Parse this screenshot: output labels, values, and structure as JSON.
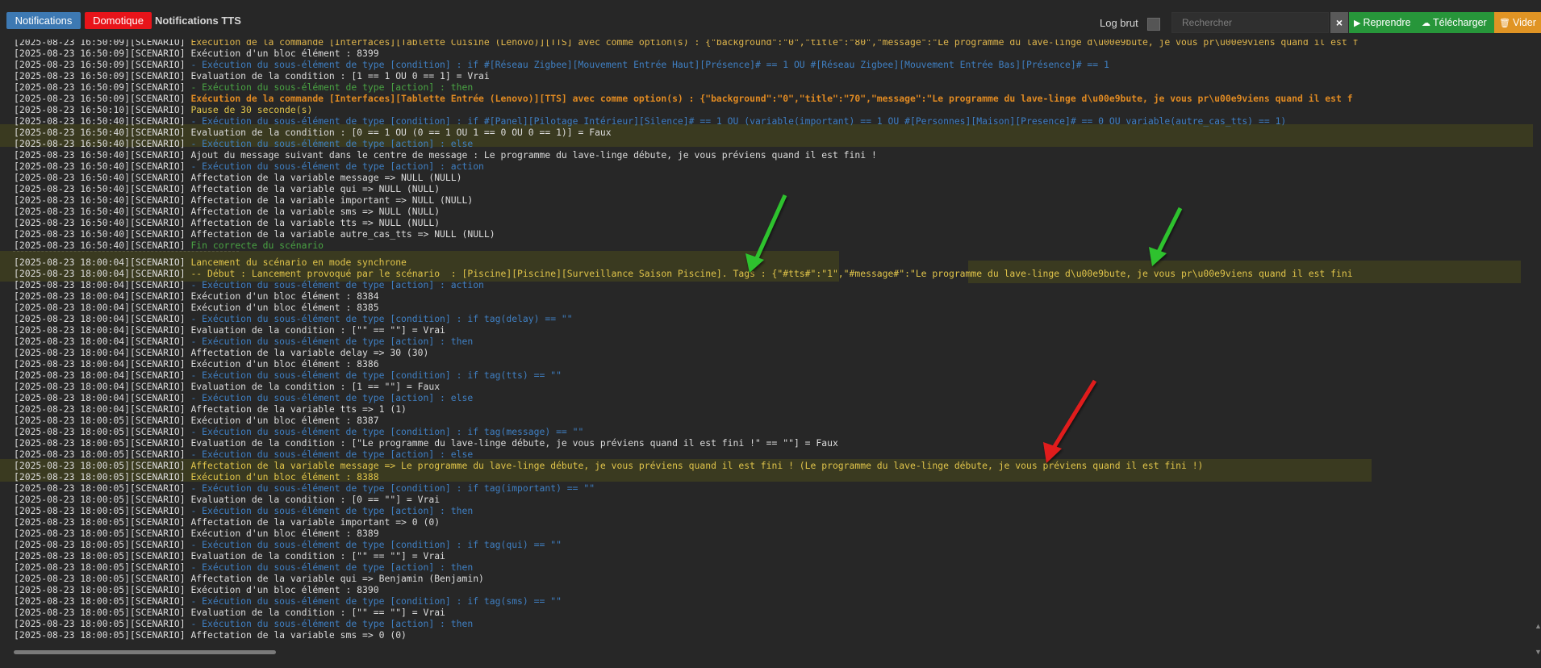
{
  "header": {
    "breadcrumb": [
      "Notifications",
      "Domotique",
      "Notifications TTS"
    ],
    "log_raw_label": "Log brut",
    "search_placeholder": "Rechercher",
    "clear_label": "×",
    "resume_label": "Reprendre",
    "download_label": "Télécharger",
    "empty_label": "Vider"
  },
  "colors": {
    "breadcrumb_1": "#3d79b3",
    "breadcrumb_2": "#e8141a",
    "resume": "#27963a",
    "download": "#27963a",
    "empty": "#e09424",
    "arrow_green": "#2ec22e",
    "arrow_red": "#e01f1f"
  },
  "icons": {
    "resume": "play-icon",
    "download": "cloud-download-icon",
    "empty": "trash-icon",
    "clear": "close-icon"
  },
  "log": [
    {
      "ts": "[2025-08-23 16:50:09][SCENARIO]",
      "text": " Exécution de la commande [Interfaces][Tablette Cuisine (Lenovo)][TTS] avec comme option(s) : {\"background\":\"0\",\"title\":\"80\",\"message\":\"Le programme du lave-linge d\\u00e9bute, je vous pr\\u00e9viens quand il est f",
      "cls": "t-warn"
    },
    {
      "ts": "[2025-08-23 16:50:09][SCENARIO]",
      "text": " Exécution d'un bloc élément : 8399",
      "cls": ""
    },
    {
      "ts": "[2025-08-23 16:50:09][SCENARIO]",
      "text": " - Exécution du sous-élément de type [condition] : if #[Réseau Zigbee][Mouvement Entrée Haut][Présence]# == 1 OU #[Réseau Zigbee][Mouvement Entrée Bas][Présence]# == 1",
      "cls": "split-blue"
    },
    {
      "ts": "[2025-08-23 16:50:09][SCENARIO]",
      "text": " Evaluation de la condition : [1 == 1 OU 0 == 1] = Vrai",
      "cls": ""
    },
    {
      "ts": "[2025-08-23 16:50:09][SCENARIO]",
      "text": " - Exécution du sous-élément de type [action] : then",
      "cls": "split-green"
    },
    {
      "ts": "[2025-08-23 16:50:09][SCENARIO]",
      "text": " Exécution de la commande [Interfaces][Tablette Entrée (Lenovo)][TTS] avec comme option(s) : {\"background\":\"0\",\"title\":\"70\",\"message\":\"Le programme du lave-linge d\\u00e9bute, je vous pr\\u00e9viens quand il est f",
      "cls": "split-orange"
    },
    {
      "ts": "[2025-08-23 16:50:10][SCENARIO]",
      "text": " Pause de 30 seconde(s)",
      "cls": "t-yellow"
    },
    {
      "ts": "[2025-08-23 16:50:40][SCENARIO]",
      "text": " - Exécution du sous-élément de type [condition] : if #[Panel][Pilotage Intérieur][Silence]# == 1 OU (variable(important) == 1 OU #[Personnes][Maison][Presence]# == 0 OU variable(autre_cas_tts) == 1)",
      "cls": "split-blue"
    },
    {
      "ts": "[2025-08-23 16:50:40][SCENARIO]",
      "text": " Evaluation de la condition : [0 == 1 OU (0 == 1 OU 1 == 0 OU 0 == 1)] = Faux",
      "cls": ""
    },
    {
      "ts": "[2025-08-23 16:50:40][SCENARIO]",
      "text": " - Exécution du sous-élément de type [action] : else",
      "cls": "split-blue"
    },
    {
      "ts": "[2025-08-23 16:50:40][SCENARIO]",
      "text": " Ajout du message suivant dans le centre de message : Le programme du lave-linge débute, je vous préviens quand il est fini !",
      "cls": ""
    },
    {
      "ts": "[2025-08-23 16:50:40][SCENARIO]",
      "text": " - Exécution du sous-élément de type [action] : action",
      "cls": "split-blue"
    },
    {
      "ts": "[2025-08-23 16:50:40][SCENARIO]",
      "text": " Affectation de la variable message => NULL (NULL)",
      "cls": ""
    },
    {
      "ts": "[2025-08-23 16:50:40][SCENARIO]",
      "text": " Affectation de la variable qui => NULL (NULL)",
      "cls": ""
    },
    {
      "ts": "[2025-08-23 16:50:40][SCENARIO]",
      "text": " Affectation de la variable important => NULL (NULL)",
      "cls": ""
    },
    {
      "ts": "[2025-08-23 16:50:40][SCENARIO]",
      "text": " Affectation de la variable sms => NULL (NULL)",
      "cls": ""
    },
    {
      "ts": "[2025-08-23 16:50:40][SCENARIO]",
      "text": " Affectation de la variable tts => NULL (NULL)",
      "cls": ""
    },
    {
      "ts": "[2025-08-23 16:50:40][SCENARIO]",
      "text": " Affectation de la variable autre_cas_tts => NULL (NULL)",
      "cls": ""
    },
    {
      "ts": "[2025-08-23 16:50:40][SCENARIO]",
      "text": " Fin correcte du scénario",
      "cls": "t-green"
    },
    {
      "sep": true
    },
    {
      "ts": "[2025-08-23 18:00:04][SCENARIO]",
      "text": " Lancement du scénario en mode synchrone",
      "cls": "t-yellow"
    },
    {
      "ts": "[2025-08-23 18:00:04][SCENARIO]",
      "text": " -- Début : Lancement provoqué par le scénario  : [Piscine][Piscine][Surveillance Saison Piscine]. Tags : {\"#tts#\":\"1\",\"#message#\":\"Le programme du lave-linge d\\u00e9bute, je vous pr\\u00e9viens quand il est fini",
      "cls": "split-start"
    },
    {
      "ts": "[2025-08-23 18:00:04][SCENARIO]",
      "text": " - Exécution du sous-élément de type [action] : action",
      "cls": "split-blue"
    },
    {
      "ts": "[2025-08-23 18:00:04][SCENARIO]",
      "text": " Exécution d'un bloc élément : 8384",
      "cls": ""
    },
    {
      "ts": "[2025-08-23 18:00:04][SCENARIO]",
      "text": " Exécution d'un bloc élément : 8385",
      "cls": ""
    },
    {
      "ts": "[2025-08-23 18:00:04][SCENARIO]",
      "text": " - Exécution du sous-élément de type [condition] : if tag(delay) == \"\"",
      "cls": "split-blue"
    },
    {
      "ts": "[2025-08-23 18:00:04][SCENARIO]",
      "text": " Evaluation de la condition : [\"\" == \"\"] = Vrai",
      "cls": ""
    },
    {
      "ts": "[2025-08-23 18:00:04][SCENARIO]",
      "text": " - Exécution du sous-élément de type [action] : then",
      "cls": "split-blue"
    },
    {
      "ts": "[2025-08-23 18:00:04][SCENARIO]",
      "text": " Affectation de la variable delay => 30 (30)",
      "cls": ""
    },
    {
      "ts": "[2025-08-23 18:00:04][SCENARIO]",
      "text": " Exécution d'un bloc élément : 8386",
      "cls": ""
    },
    {
      "ts": "[2025-08-23 18:00:04][SCENARIO]",
      "text": " - Exécution du sous-élément de type [condition] : if tag(tts) == \"\"",
      "cls": "split-blue"
    },
    {
      "ts": "[2025-08-23 18:00:04][SCENARIO]",
      "text": " Evaluation de la condition : [1 == \"\"] = Faux",
      "cls": ""
    },
    {
      "ts": "[2025-08-23 18:00:04][SCENARIO]",
      "text": " - Exécution du sous-élément de type [action] : else",
      "cls": "split-blue"
    },
    {
      "ts": "[2025-08-23 18:00:04][SCENARIO]",
      "text": " Affectation de la variable tts => 1 (1)",
      "cls": ""
    },
    {
      "ts": "[2025-08-23 18:00:05][SCENARIO]",
      "text": " Exécution d'un bloc élément : 8387",
      "cls": ""
    },
    {
      "ts": "[2025-08-23 18:00:05][SCENARIO]",
      "text": " - Exécution du sous-élément de type [condition] : if tag(message) == \"\"",
      "cls": "split-blue"
    },
    {
      "ts": "[2025-08-23 18:00:05][SCENARIO]",
      "text": " Evaluation de la condition : [\"Le programme du lave-linge débute, je vous préviens quand il est fini !\" == \"\"] = Faux",
      "cls": ""
    },
    {
      "ts": "[2025-08-23 18:00:05][SCENARIO]",
      "text": " - Exécution du sous-élément de type [action] : else",
      "cls": "split-blue"
    },
    {
      "ts": "[2025-08-23 18:00:05][SCENARIO]",
      "text": " Affectation de la variable message => Le programme du lave-linge débute, je vous préviens quand il est fini ! (Le programme du lave-linge débute, je vous préviens quand il est fini !)",
      "cls": "t-yellow"
    },
    {
      "ts": "[2025-08-23 18:00:05][SCENARIO]",
      "text": " Exécution d'un bloc élément : 8388",
      "cls": "t-yellow"
    },
    {
      "ts": "[2025-08-23 18:00:05][SCENARIO]",
      "text": " - Exécution du sous-élément de type [condition] : if tag(important) == \"\"",
      "cls": "split-blue"
    },
    {
      "ts": "[2025-08-23 18:00:05][SCENARIO]",
      "text": " Evaluation de la condition : [0 == \"\"] = Vrai",
      "cls": ""
    },
    {
      "ts": "[2025-08-23 18:00:05][SCENARIO]",
      "text": " - Exécution du sous-élément de type [action] : then",
      "cls": "split-blue"
    },
    {
      "ts": "[2025-08-23 18:00:05][SCENARIO]",
      "text": " Affectation de la variable important => 0 (0)",
      "cls": ""
    },
    {
      "ts": "[2025-08-23 18:00:05][SCENARIO]",
      "text": " Exécution d'un bloc élément : 8389",
      "cls": ""
    },
    {
      "ts": "[2025-08-23 18:00:05][SCENARIO]",
      "text": " - Exécution du sous-élément de type [condition] : if tag(qui) == \"\"",
      "cls": "split-blue"
    },
    {
      "ts": "[2025-08-23 18:00:05][SCENARIO]",
      "text": " Evaluation de la condition : [\"\" == \"\"] = Vrai",
      "cls": ""
    },
    {
      "ts": "[2025-08-23 18:00:05][SCENARIO]",
      "text": " - Exécution du sous-élément de type [action] : then",
      "cls": "split-blue"
    },
    {
      "ts": "[2025-08-23 18:00:05][SCENARIO]",
      "text": " Affectation de la variable qui => Benjamin (Benjamin)",
      "cls": ""
    },
    {
      "ts": "[2025-08-23 18:00:05][SCENARIO]",
      "text": " Exécution d'un bloc élément : 8390",
      "cls": ""
    },
    {
      "ts": "[2025-08-23 18:00:05][SCENARIO]",
      "text": " - Exécution du sous-élément de type [condition] : if tag(sms) == \"\"",
      "cls": "split-blue"
    },
    {
      "ts": "[2025-08-23 18:00:05][SCENARIO]",
      "text": " Evaluation de la condition : [\"\" == \"\"] = Vrai",
      "cls": ""
    },
    {
      "ts": "[2025-08-23 18:00:05][SCENARIO]",
      "text": " - Exécution du sous-élément de type [action] : then",
      "cls": "split-blue"
    },
    {
      "ts": "[2025-08-23 18:00:05][SCENARIO]",
      "text": " Affectation de la variable sms => 0 (0)",
      "cls": ""
    }
  ]
}
